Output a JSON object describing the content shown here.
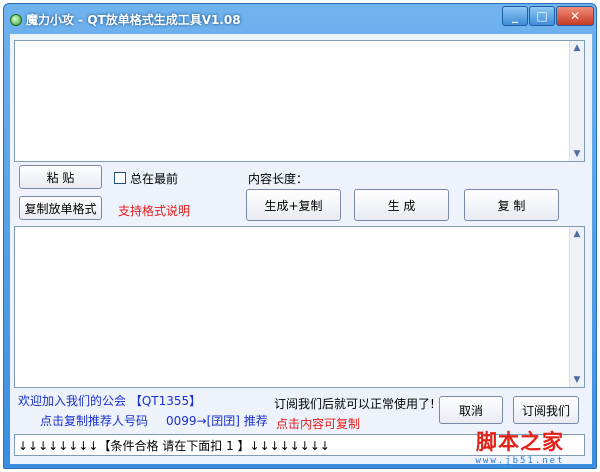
{
  "window": {
    "title": "魔力小攻 - QT放单格式生成工具V1.08",
    "min_glyph": "_",
    "max_glyph": "□",
    "close_glyph": "✕"
  },
  "controls": {
    "paste_label": "粘 贴",
    "copy_format_label": "复制放单格式",
    "always_on_top_label": "总在最前",
    "format_help_label": "支持格式说明",
    "content_length_label": "内容长度：",
    "generate_copy_label": "生成+复制",
    "generate_label": "生 成",
    "copy_label": "复 制"
  },
  "footer": {
    "welcome_text": "欢迎加入我们的公会 【QT1355】",
    "copy_referrer_text": "点击复制推荐人号码",
    "referrer_text": "0099→[囝囝] 推荐",
    "subscribe_text": "订阅我们后就可以正常使用了!",
    "copyable_hint": "点击内容可复制",
    "btn_left_label": "取消",
    "btn_right_label": "订阅我们",
    "bottom_text": "↓↓↓↓↓↓↓↓【条件合格 请在下面扣 1 】↓↓↓↓↓↓↓↓"
  },
  "watermark": {
    "main": "脚本之家",
    "sub": "www.jb51.net"
  }
}
